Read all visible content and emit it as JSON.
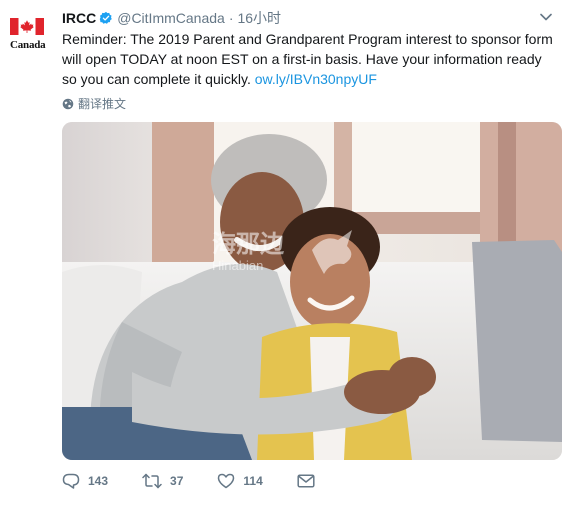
{
  "account": {
    "display_name": "IRCC",
    "handle": "@CitImmCanada",
    "separator": "·",
    "time": "16小时",
    "logo_text": "Canada"
  },
  "tweet": {
    "text": "Reminder: The 2019 Parent and Grandparent Program interest to sponsor form will open TODAY at noon EST on a first-in basis. Have your information ready so you can complete it quickly.",
    "link": "ow.ly/IBVn30npyUF",
    "translate_label": "翻译推文"
  },
  "photo": {
    "watermark_text": "海那边",
    "watermark_subtext": "Hinabian"
  },
  "actions": {
    "reply_count": "143",
    "retweet_count": "37",
    "like_count": "114"
  },
  "colors": {
    "accent": "#1b95e0",
    "muted": "#657786",
    "flag_red": "#e0242c"
  }
}
